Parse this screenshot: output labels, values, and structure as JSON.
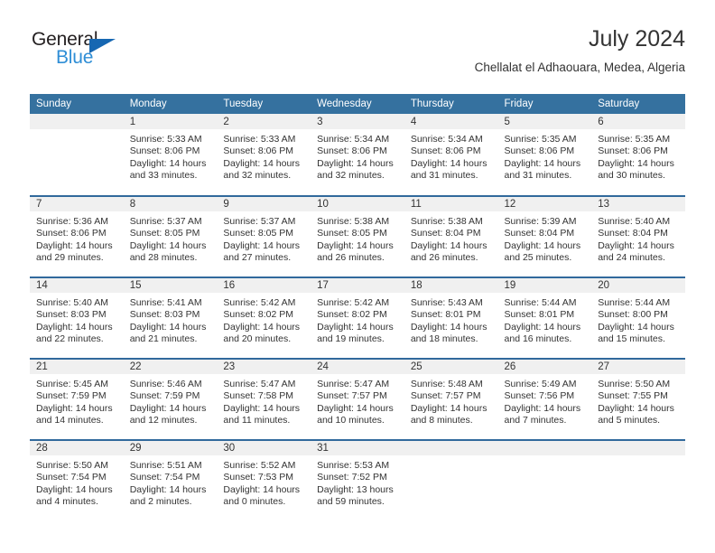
{
  "brand": {
    "name_part1": "General",
    "name_part2": "Blue",
    "triangle_color": "#1667b2",
    "blue_color": "#2f8ed6"
  },
  "header": {
    "title": "July 2024",
    "subtitle": "Chellalat el Adhaouara, Medea, Algeria",
    "accent_color": "#35719f",
    "band_color": "#f0f0f0"
  },
  "weekday_headers": [
    "Sunday",
    "Monday",
    "Tuesday",
    "Wednesday",
    "Thursday",
    "Friday",
    "Saturday"
  ],
  "labels": {
    "sunrise_prefix": "Sunrise:",
    "sunset_prefix": "Sunset:",
    "daylight_prefix": "Daylight:"
  },
  "weeks": [
    [
      {
        "day": "",
        "empty": true,
        "line1": "",
        "line2": "",
        "line3": "",
        "line4": ""
      },
      {
        "day": "1",
        "line1": "Sunrise: 5:33 AM",
        "line2": "Sunset: 8:06 PM",
        "line3": "Daylight: 14 hours",
        "line4": "and 33 minutes."
      },
      {
        "day": "2",
        "line1": "Sunrise: 5:33 AM",
        "line2": "Sunset: 8:06 PM",
        "line3": "Daylight: 14 hours",
        "line4": "and 32 minutes."
      },
      {
        "day": "3",
        "line1": "Sunrise: 5:34 AM",
        "line2": "Sunset: 8:06 PM",
        "line3": "Daylight: 14 hours",
        "line4": "and 32 minutes."
      },
      {
        "day": "4",
        "line1": "Sunrise: 5:34 AM",
        "line2": "Sunset: 8:06 PM",
        "line3": "Daylight: 14 hours",
        "line4": "and 31 minutes."
      },
      {
        "day": "5",
        "line1": "Sunrise: 5:35 AM",
        "line2": "Sunset: 8:06 PM",
        "line3": "Daylight: 14 hours",
        "line4": "and 31 minutes."
      },
      {
        "day": "6",
        "line1": "Sunrise: 5:35 AM",
        "line2": "Sunset: 8:06 PM",
        "line3": "Daylight: 14 hours",
        "line4": "and 30 minutes."
      }
    ],
    [
      {
        "day": "7",
        "line1": "Sunrise: 5:36 AM",
        "line2": "Sunset: 8:06 PM",
        "line3": "Daylight: 14 hours",
        "line4": "and 29 minutes."
      },
      {
        "day": "8",
        "line1": "Sunrise: 5:37 AM",
        "line2": "Sunset: 8:05 PM",
        "line3": "Daylight: 14 hours",
        "line4": "and 28 minutes."
      },
      {
        "day": "9",
        "line1": "Sunrise: 5:37 AM",
        "line2": "Sunset: 8:05 PM",
        "line3": "Daylight: 14 hours",
        "line4": "and 27 minutes."
      },
      {
        "day": "10",
        "line1": "Sunrise: 5:38 AM",
        "line2": "Sunset: 8:05 PM",
        "line3": "Daylight: 14 hours",
        "line4": "and 26 minutes."
      },
      {
        "day": "11",
        "line1": "Sunrise: 5:38 AM",
        "line2": "Sunset: 8:04 PM",
        "line3": "Daylight: 14 hours",
        "line4": "and 26 minutes."
      },
      {
        "day": "12",
        "line1": "Sunrise: 5:39 AM",
        "line2": "Sunset: 8:04 PM",
        "line3": "Daylight: 14 hours",
        "line4": "and 25 minutes."
      },
      {
        "day": "13",
        "line1": "Sunrise: 5:40 AM",
        "line2": "Sunset: 8:04 PM",
        "line3": "Daylight: 14 hours",
        "line4": "and 24 minutes."
      }
    ],
    [
      {
        "day": "14",
        "line1": "Sunrise: 5:40 AM",
        "line2": "Sunset: 8:03 PM",
        "line3": "Daylight: 14 hours",
        "line4": "and 22 minutes."
      },
      {
        "day": "15",
        "line1": "Sunrise: 5:41 AM",
        "line2": "Sunset: 8:03 PM",
        "line3": "Daylight: 14 hours",
        "line4": "and 21 minutes."
      },
      {
        "day": "16",
        "line1": "Sunrise: 5:42 AM",
        "line2": "Sunset: 8:02 PM",
        "line3": "Daylight: 14 hours",
        "line4": "and 20 minutes."
      },
      {
        "day": "17",
        "line1": "Sunrise: 5:42 AM",
        "line2": "Sunset: 8:02 PM",
        "line3": "Daylight: 14 hours",
        "line4": "and 19 minutes."
      },
      {
        "day": "18",
        "line1": "Sunrise: 5:43 AM",
        "line2": "Sunset: 8:01 PM",
        "line3": "Daylight: 14 hours",
        "line4": "and 18 minutes."
      },
      {
        "day": "19",
        "line1": "Sunrise: 5:44 AM",
        "line2": "Sunset: 8:01 PM",
        "line3": "Daylight: 14 hours",
        "line4": "and 16 minutes."
      },
      {
        "day": "20",
        "line1": "Sunrise: 5:44 AM",
        "line2": "Sunset: 8:00 PM",
        "line3": "Daylight: 14 hours",
        "line4": "and 15 minutes."
      }
    ],
    [
      {
        "day": "21",
        "line1": "Sunrise: 5:45 AM",
        "line2": "Sunset: 7:59 PM",
        "line3": "Daylight: 14 hours",
        "line4": "and 14 minutes."
      },
      {
        "day": "22",
        "line1": "Sunrise: 5:46 AM",
        "line2": "Sunset: 7:59 PM",
        "line3": "Daylight: 14 hours",
        "line4": "and 12 minutes."
      },
      {
        "day": "23",
        "line1": "Sunrise: 5:47 AM",
        "line2": "Sunset: 7:58 PM",
        "line3": "Daylight: 14 hours",
        "line4": "and 11 minutes."
      },
      {
        "day": "24",
        "line1": "Sunrise: 5:47 AM",
        "line2": "Sunset: 7:57 PM",
        "line3": "Daylight: 14 hours",
        "line4": "and 10 minutes."
      },
      {
        "day": "25",
        "line1": "Sunrise: 5:48 AM",
        "line2": "Sunset: 7:57 PM",
        "line3": "Daylight: 14 hours",
        "line4": "and 8 minutes."
      },
      {
        "day": "26",
        "line1": "Sunrise: 5:49 AM",
        "line2": "Sunset: 7:56 PM",
        "line3": "Daylight: 14 hours",
        "line4": "and 7 minutes."
      },
      {
        "day": "27",
        "line1": "Sunrise: 5:50 AM",
        "line2": "Sunset: 7:55 PM",
        "line3": "Daylight: 14 hours",
        "line4": "and 5 minutes."
      }
    ],
    [
      {
        "day": "28",
        "line1": "Sunrise: 5:50 AM",
        "line2": "Sunset: 7:54 PM",
        "line3": "Daylight: 14 hours",
        "line4": "and 4 minutes."
      },
      {
        "day": "29",
        "line1": "Sunrise: 5:51 AM",
        "line2": "Sunset: 7:54 PM",
        "line3": "Daylight: 14 hours",
        "line4": "and 2 minutes."
      },
      {
        "day": "30",
        "line1": "Sunrise: 5:52 AM",
        "line2": "Sunset: 7:53 PM",
        "line3": "Daylight: 14 hours",
        "line4": "and 0 minutes."
      },
      {
        "day": "31",
        "line1": "Sunrise: 5:53 AM",
        "line2": "Sunset: 7:52 PM",
        "line3": "Daylight: 13 hours",
        "line4": "and 59 minutes."
      },
      {
        "day": "",
        "empty": true,
        "line1": "",
        "line2": "",
        "line3": "",
        "line4": ""
      },
      {
        "day": "",
        "empty": true,
        "line1": "",
        "line2": "",
        "line3": "",
        "line4": ""
      },
      {
        "day": "",
        "empty": true,
        "line1": "",
        "line2": "",
        "line3": "",
        "line4": ""
      }
    ]
  ]
}
